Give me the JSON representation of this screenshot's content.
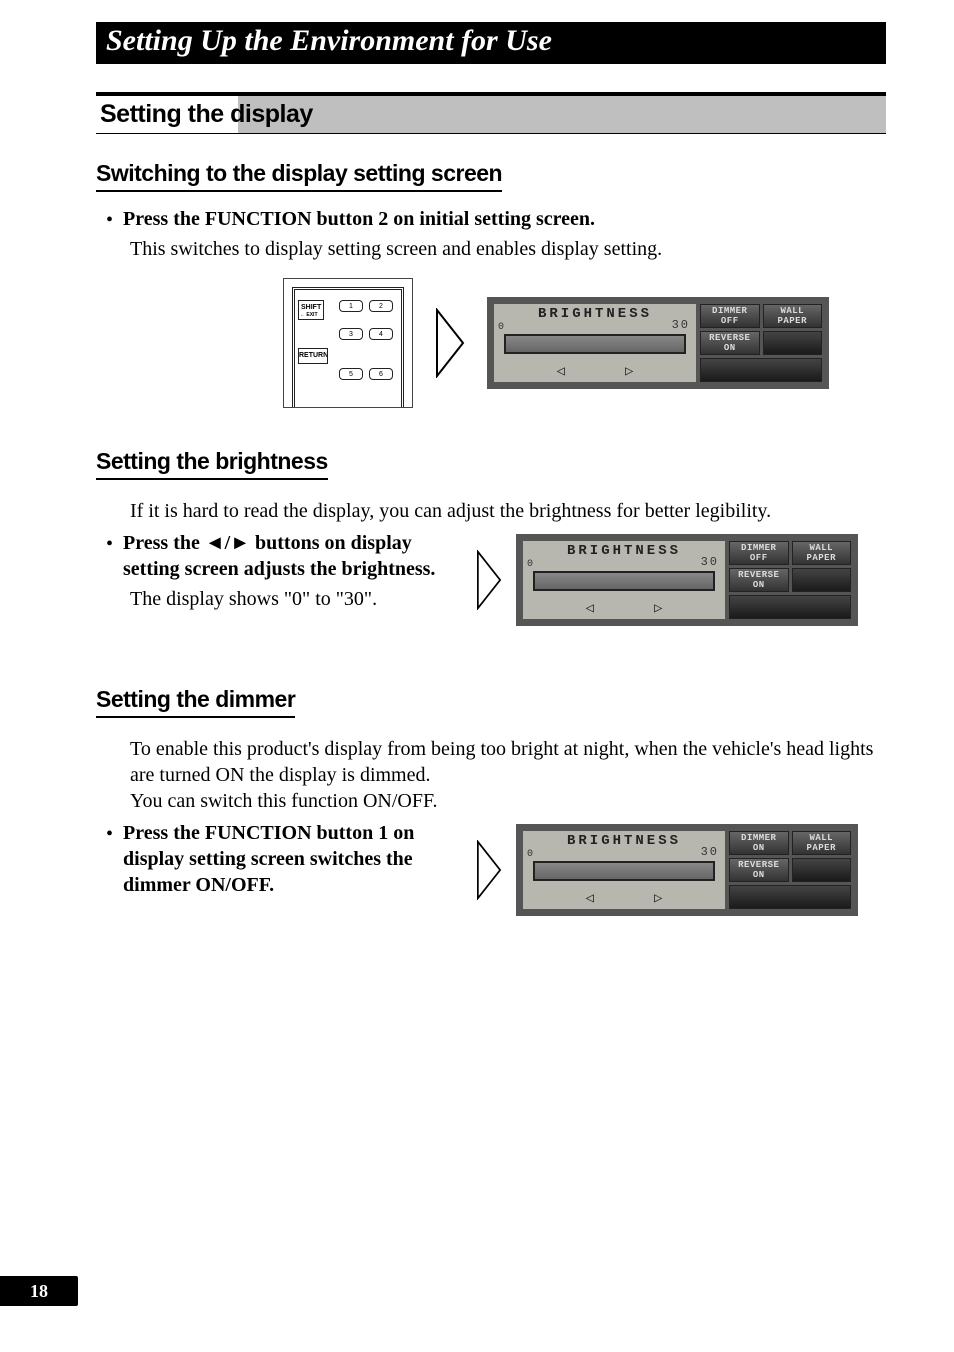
{
  "chapter_title": "Setting Up the Environment for Use",
  "section_title": "Setting the display",
  "sub1": {
    "heading": "Switching to the display setting screen",
    "bullet_bold": "Press the FUNCTION button 2 on initial setting screen.",
    "bullet_body": "This switches to display setting screen and enables display setting.",
    "remote": {
      "shift_label": "SHIFT",
      "exit_label": "← EXIT",
      "return_label": "RETURN",
      "keys": [
        "1",
        "2",
        "3",
        "4",
        "5",
        "6"
      ]
    },
    "lcd": {
      "title": "BRIGHTNESS",
      "scale_left": "0",
      "scale_right": "30",
      "nav_left": "◁",
      "nav_right": "▷",
      "btn_dimmer_top": "DIMMER",
      "btn_dimmer_bot": "OFF",
      "btn_wall_top": "WALL",
      "btn_wall_bot": "PAPER",
      "btn_rev_top": "REVERSE",
      "btn_rev_bot": "ON"
    }
  },
  "sub2": {
    "heading": "Setting the brightness",
    "intro": "If it is hard to read the display, you can adjust the brightness for better legibility.",
    "bullet_bold_pre": "Press the ",
    "bullet_bold_mid": "◄/►",
    "bullet_bold_post": " buttons on display setting screen adjusts the brightness.",
    "bullet_body": "The display shows \"0\" to \"30\".",
    "lcd": {
      "title": "BRIGHTNESS",
      "scale_left": "0",
      "scale_right": "30",
      "nav_left": "◁",
      "nav_right": "▷",
      "btn_dimmer_top": "DIMMER",
      "btn_dimmer_bot": "OFF",
      "btn_wall_top": "WALL",
      "btn_wall_bot": "PAPER",
      "btn_rev_top": "REVERSE",
      "btn_rev_bot": "ON"
    }
  },
  "sub3": {
    "heading": "Setting the dimmer",
    "intro": "To enable this product's display from being too bright at night, when the vehicle's head lights are turned ON the display is dimmed.\nYou can switch this function ON/OFF.",
    "bullet_bold": "Press the FUNCTION button 1 on display setting screen switches the dimmer ON/OFF.",
    "lcd": {
      "title": "BRIGHTNESS",
      "scale_left": "0",
      "scale_right": "30",
      "nav_left": "◁",
      "nav_right": "▷",
      "btn_dimmer_top": "DIMMER",
      "btn_dimmer_bot": "ON",
      "btn_wall_top": "WALL",
      "btn_wall_bot": "PAPER",
      "btn_rev_top": "REVERSE",
      "btn_rev_bot": "ON"
    }
  },
  "page_number": "18"
}
